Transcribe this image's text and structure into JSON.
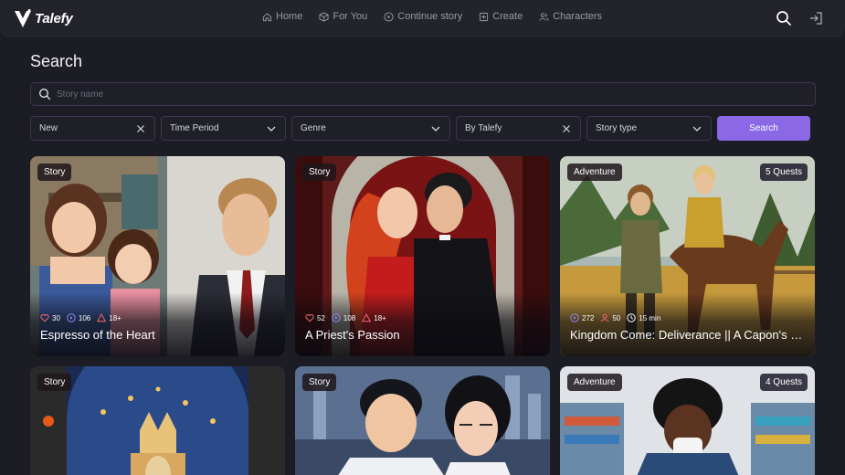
{
  "app": {
    "logo_text": "Talefy"
  },
  "nav": [
    {
      "label": "Home",
      "icon": "home-icon"
    },
    {
      "label": "For You",
      "icon": "cube-icon"
    },
    {
      "label": "Continue story",
      "icon": "play-circle-icon"
    },
    {
      "label": "Create",
      "icon": "plus-square-icon"
    },
    {
      "label": "Characters",
      "icon": "users-icon"
    }
  ],
  "header_actions": {
    "search_icon": "search-icon",
    "login_icon": "sign-in-icon"
  },
  "search": {
    "title": "Search",
    "placeholder": "Story name",
    "value": ""
  },
  "filters": {
    "sort": "New",
    "time_period": "Time Period",
    "genre": "Genre",
    "author": "By Talefy",
    "story_type": "Story type",
    "button_label": "Search"
  },
  "colors": {
    "accent": "#8b68e6",
    "background": "#1c1c24",
    "topbar": "#23232c"
  },
  "cards": [
    {
      "tag": "Story",
      "quests": "",
      "title": "Espresso of the Heart",
      "likes": "30",
      "plays": "106",
      "rating": "18+"
    },
    {
      "tag": "Story",
      "quests": "",
      "title": "A Priest's Passion",
      "likes": "52",
      "plays": "108",
      "rating": "18+"
    },
    {
      "tag": "Adventure",
      "quests": "5 Quests",
      "title": "Kingdom Come: Deliverance || A Capon's P...",
      "plays": "272",
      "players": "50",
      "duration": "15 min"
    },
    {
      "tag": "Story",
      "quests": "",
      "title": ""
    },
    {
      "tag": "Story",
      "quests": "",
      "title": ""
    },
    {
      "tag": "Adventure",
      "quests": "4 Quests",
      "title": ""
    }
  ]
}
